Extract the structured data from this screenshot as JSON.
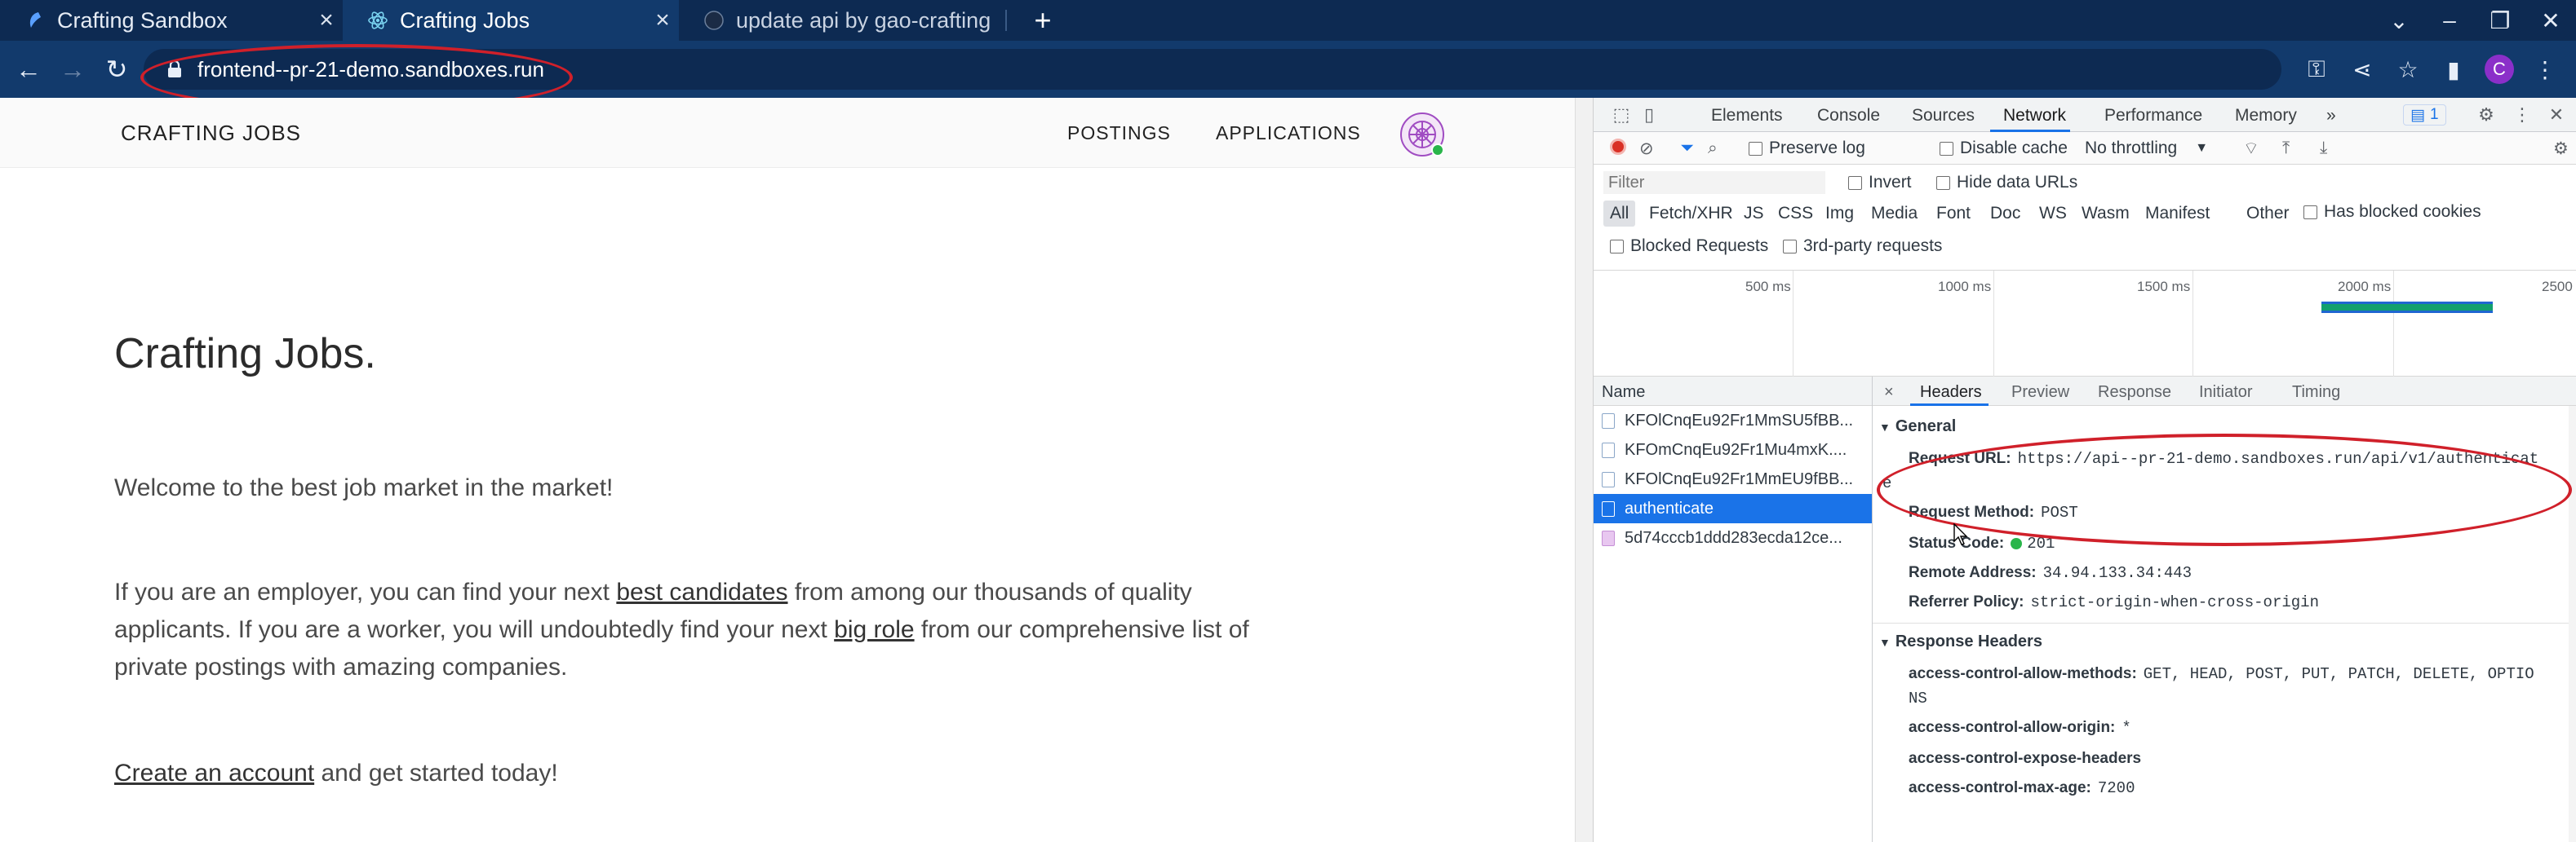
{
  "browser": {
    "tabs": [
      {
        "title": "Crafting Sandbox",
        "active": false
      },
      {
        "title": "Crafting Jobs",
        "active": true
      },
      {
        "title": "update api by gao-crafting",
        "active": false
      }
    ],
    "url": "frontend--pr-21-demo.sandboxes.run",
    "profile_initial": "C",
    "colors": {
      "chrome": "#123a6c",
      "tabstrip": "#0d2a52",
      "annotation": "#d0202a"
    }
  },
  "site": {
    "brand": "CRAFTING JOBS",
    "nav": {
      "postings": "POSTINGS",
      "applications": "APPLICATIONS"
    },
    "hero_title": "Crafting Jobs.",
    "welcome": "Welcome to the best job market in the market!",
    "intro": {
      "part1": "If you are an employer, you can find your next ",
      "link1": "best candidates",
      "part2": " from among our thousands of quality applicants. If you are a worker, you will undoubtedly find your next ",
      "link2": "big role",
      "part3": " from our comprehensive list of private postings with amazing companies."
    },
    "cta": {
      "link": "Create an account",
      "rest": " and get started today!"
    }
  },
  "devtools": {
    "tabs": [
      "Elements",
      "Console",
      "Sources",
      "Network",
      "Performance",
      "Memory"
    ],
    "active_tab": "Network",
    "more_tabs": "»",
    "issues_count": "1",
    "toolbar": {
      "preserve_log": "Preserve log",
      "disable_cache": "Disable cache",
      "throttling": "No throttling"
    },
    "filter": {
      "placeholder": "Filter",
      "invert": "Invert",
      "hide_data_urls": "Hide data URLs",
      "types": [
        "All",
        "Fetch/XHR",
        "JS",
        "CSS",
        "Img",
        "Media",
        "Font",
        "Doc",
        "WS",
        "Wasm",
        "Manifest",
        "Other"
      ],
      "has_blocked_cookies": "Has blocked cookies",
      "blocked_requests": "Blocked Requests",
      "third_party": "3rd-party requests"
    },
    "timeline": {
      "ticks": [
        "500 ms",
        "1000 ms",
        "1500 ms",
        "2000 ms",
        "2500"
      ]
    },
    "requests": {
      "header": "Name",
      "rows": [
        {
          "name": "KFOlCnqEu92Fr1MmSU5fBB...",
          "selected": false,
          "kind": "doc"
        },
        {
          "name": "KFOmCnqEu92Fr1Mu4mxK....",
          "selected": false,
          "kind": "doc"
        },
        {
          "name": "KFOlCnqEu92Fr1MmEU9fBB...",
          "selected": false,
          "kind": "doc"
        },
        {
          "name": "authenticate",
          "selected": true,
          "kind": "doc"
        },
        {
          "name": "5d74cccb1ddd283ecda12ce...",
          "selected": false,
          "kind": "img"
        }
      ]
    },
    "details": {
      "close": "×",
      "tabs": [
        "Headers",
        "Preview",
        "Response",
        "Initiator",
        "Timing"
      ],
      "active_tab": "Headers",
      "general_title": "General",
      "general": {
        "request_url_key": "Request URL:",
        "request_url": "https://api--pr-21-demo.sandboxes.run/api/v1/authenticat",
        "request_url_wrap": "e",
        "method_key": "Request Method:",
        "method": "POST",
        "status_key": "Status Code:",
        "status": "201",
        "remote_key": "Remote Address:",
        "remote": "34.94.133.34:443",
        "referrer_key": "Referrer Policy:",
        "referrer": "strict-origin-when-cross-origin"
      },
      "response_title": "Response Headers",
      "response": {
        "acam_key": "access-control-allow-methods:",
        "acam": "GET, HEAD, POST, PUT, PATCH, DELETE, OPTIO",
        "acam_wrap": "NS",
        "acao_key": "access-control-allow-origin:",
        "acao": "*",
        "aceh_key": "access-control-expose-headers",
        "acma_key": "access-control-max-age:",
        "acma": "7200"
      }
    }
  }
}
